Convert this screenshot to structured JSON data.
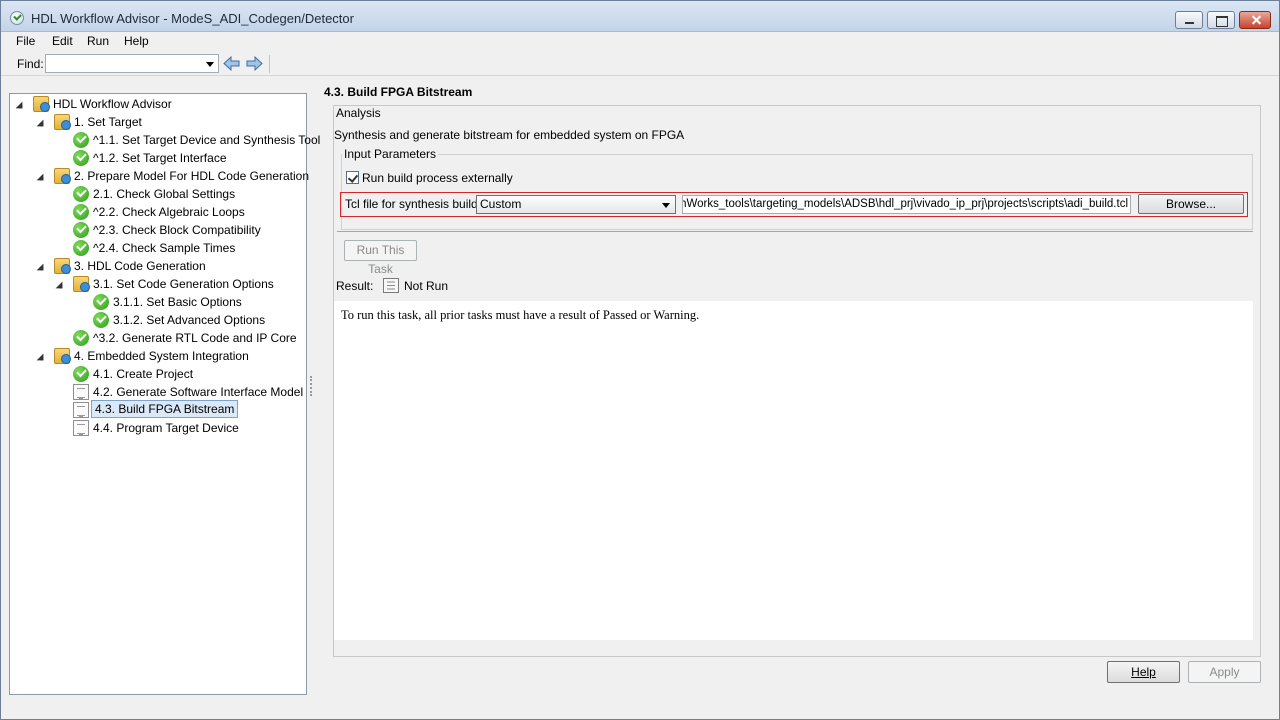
{
  "window": {
    "title": "HDL Workflow Advisor - ModeS_ADI_Codegen/Detector"
  },
  "menu": {
    "items": [
      "File",
      "Edit",
      "Run",
      "Help"
    ]
  },
  "toolbar": {
    "find_label": "Find:",
    "find_value": ""
  },
  "tree": {
    "items": [
      {
        "label": "HDL Workflow Advisor",
        "icon": "folder-icon",
        "expanded": true
      },
      {
        "label": "1. Set Target",
        "icon": "folder-icon",
        "expanded": true
      },
      {
        "label": "^1.1. Set Target Device and Synthesis Tool",
        "icon": "passed-check-icon"
      },
      {
        "label": "^1.2. Set Target Interface",
        "icon": "passed-check-icon"
      },
      {
        "label": "2. Prepare Model For HDL Code Generation",
        "icon": "folder-icon",
        "expanded": true
      },
      {
        "label": "2.1. Check Global Settings",
        "icon": "passed-check-icon"
      },
      {
        "label": "^2.2. Check Algebraic Loops",
        "icon": "passed-check-icon"
      },
      {
        "label": "^2.3. Check Block Compatibility",
        "icon": "passed-check-icon"
      },
      {
        "label": "^2.4. Check Sample Times",
        "icon": "passed-check-icon"
      },
      {
        "label": "3. HDL Code Generation",
        "icon": "folder-icon",
        "expanded": true
      },
      {
        "label": "3.1. Set Code Generation Options",
        "icon": "folder-icon",
        "expanded": true
      },
      {
        "label": "3.1.1. Set Basic Options",
        "icon": "passed-check-icon"
      },
      {
        "label": "3.1.2. Set Advanced Options",
        "icon": "passed-check-icon"
      },
      {
        "label": "^3.2. Generate RTL Code and IP Core",
        "icon": "passed-check-icon"
      },
      {
        "label": "4. Embedded System Integration",
        "icon": "folder-icon",
        "expanded": true
      },
      {
        "label": "4.1. Create Project",
        "icon": "passed-check-icon"
      },
      {
        "label": "4.2. Generate Software Interface Model",
        "icon": "not-run-doc-icon"
      },
      {
        "label": "4.3. Build FPGA Bitstream",
        "icon": "not-run-doc-icon",
        "selected": true
      },
      {
        "label": "4.4. Program Target Device",
        "icon": "not-run-doc-icon"
      }
    ]
  },
  "main": {
    "task_title": "4.3. Build FPGA Bitstream",
    "analysis_legend": "Analysis",
    "analysis_description": "Synthesis and generate bitstream for embedded system on FPGA",
    "params_legend": "Input Parameters",
    "run_externally_label": "Run build process externally",
    "run_externally_checked": true,
    "tcl_label": "Tcl file for synthesis build:",
    "tcl_selected": "Custom",
    "tcl_path": "MathWorks_tools\\targeting_models\\ADSB\\hdl_prj\\vivado_ip_prj\\projects\\scripts\\adi_build.tcl",
    "browse_label": "Browse...",
    "run_task_label": "Run This Task",
    "result_label": "Result:",
    "result_value": "Not Run",
    "result_message": "To run this task, all prior tasks must have a result of Passed or Warning."
  },
  "footer": {
    "help_label": "Help",
    "apply_label": "Apply"
  },
  "colors": {
    "selection_bg": "#dbe8f8",
    "highlight_frame": "#d3272b",
    "pass_green": "#2c9b1a"
  }
}
